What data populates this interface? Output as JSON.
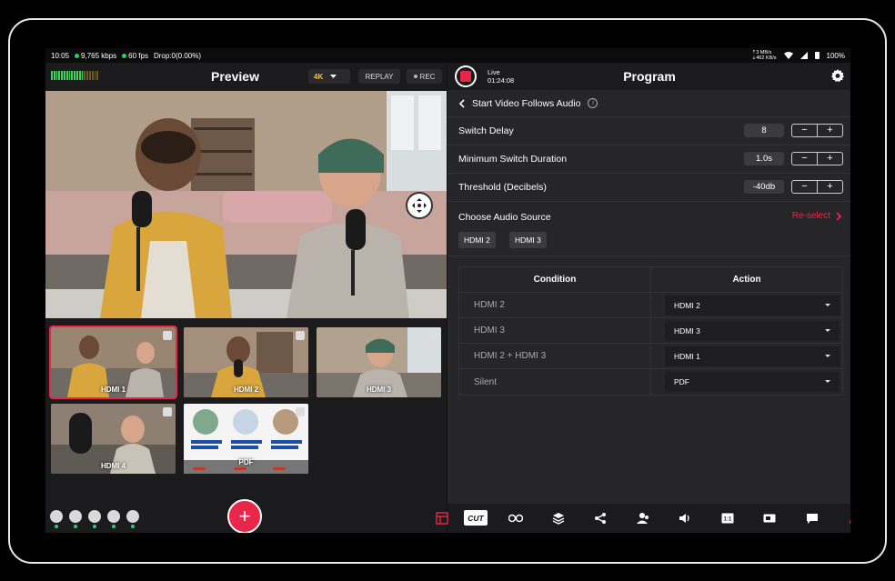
{
  "status_bar": {
    "time": "10:05",
    "bitrate": "9,765 kbps",
    "fps": "60 fps",
    "drop": "Drop:0(0.00%)",
    "net_up": "3 MB/s",
    "net_down": "462 KB/s",
    "battery": "100%"
  },
  "preview": {
    "title": "Preview",
    "resolution": "4K",
    "replay_label": "REPLAY",
    "rec_label": "REC"
  },
  "sources": [
    {
      "label": "HDMI 1",
      "active": true
    },
    {
      "label": "HDMI 2",
      "active": false
    },
    {
      "label": "HDMI 3",
      "active": false
    },
    {
      "label": "HDMI 4",
      "active": false
    },
    {
      "label": "PDF",
      "active": false
    }
  ],
  "program": {
    "title": "Program",
    "live_label": "Live",
    "live_time": "01:24:08"
  },
  "vfa": {
    "title": "Start Video Follows Audio",
    "settings": [
      {
        "label": "Switch Delay",
        "value": "8"
      },
      {
        "label": "Minimum Switch Duration",
        "value": "1.0s"
      },
      {
        "label": "Threshold (Decibels)",
        "value": "-40db"
      }
    ],
    "audio_source_label": "Choose Audio Source",
    "reselect_label": "Re-select",
    "selected_sources": [
      "HDMI 2",
      "HDMI 3"
    ],
    "table": {
      "headers": [
        "Condition",
        "Action"
      ],
      "rows": [
        {
          "condition": "HDMI 2",
          "action": "HDMI 2"
        },
        {
          "condition": "HDMI 3",
          "action": "HDMI 3"
        },
        {
          "condition": "HDMI 2 + HDMI 3",
          "action": "HDMI 1"
        },
        {
          "condition": "Silent",
          "action": "PDF"
        }
      ]
    }
  },
  "toolbar": {
    "cut_label": "CUT"
  },
  "colors": {
    "accent": "#e8274b",
    "live_dot": "#2ecc71",
    "resolution": "#f2c14b"
  }
}
